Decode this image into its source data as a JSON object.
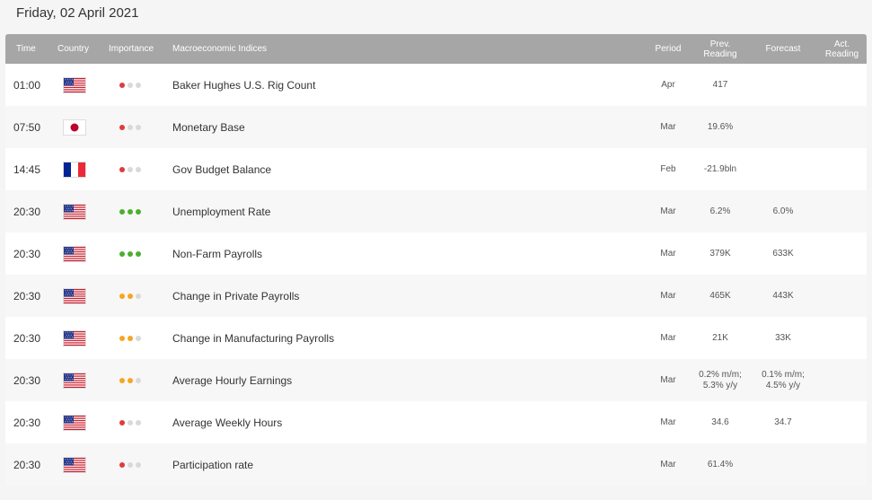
{
  "date_title": "Friday, 02 April 2021",
  "header": {
    "time": "Time",
    "country": "Country",
    "importance": "Importance",
    "indices": "Macroeconomic Indices",
    "period": "Period",
    "prev": "Prev.\nReading",
    "forecast": "Forecast",
    "actual": "Act.\nReading"
  },
  "colors": {
    "header_bg": "#a6a6a6",
    "importance_high": "#4caf2f",
    "importance_medium": "#f5a623",
    "importance_low": "#e03b3b",
    "importance_off": "#d9d9d9"
  },
  "rows": [
    {
      "time": "01:00",
      "country": "us",
      "importance": "low",
      "name": "Baker Hughes U.S. Rig Count",
      "period": "Apr",
      "prev": "417",
      "forecast": "",
      "actual": ""
    },
    {
      "time": "07:50",
      "country": "jp",
      "importance": "low",
      "name": "Monetary Base",
      "period": "Mar",
      "prev": "19.6%",
      "forecast": "",
      "actual": ""
    },
    {
      "time": "14:45",
      "country": "fr",
      "importance": "low",
      "name": "Gov Budget Balance",
      "period": "Feb",
      "prev": "-21.9bln",
      "forecast": "",
      "actual": ""
    },
    {
      "time": "20:30",
      "country": "us",
      "importance": "high",
      "name": "Unemployment Rate",
      "period": "Mar",
      "prev": "6.2%",
      "forecast": "6.0%",
      "actual": ""
    },
    {
      "time": "20:30",
      "country": "us",
      "importance": "high",
      "name": "Non-Farm Payrolls",
      "period": "Mar",
      "prev": "379K",
      "forecast": "633K",
      "actual": ""
    },
    {
      "time": "20:30",
      "country": "us",
      "importance": "medium",
      "name": "Change in Private Payrolls",
      "period": "Mar",
      "prev": "465K",
      "forecast": "443K",
      "actual": ""
    },
    {
      "time": "20:30",
      "country": "us",
      "importance": "medium",
      "name": "Change in Manufacturing Payrolls",
      "period": "Mar",
      "prev": "21K",
      "forecast": "33K",
      "actual": ""
    },
    {
      "time": "20:30",
      "country": "us",
      "importance": "medium",
      "name": "Average Hourly Earnings",
      "period": "Mar",
      "prev": "0.2% m/m;\n5.3% y/y",
      "forecast": "0.1% m/m;\n4.5% y/y",
      "actual": ""
    },
    {
      "time": "20:30",
      "country": "us",
      "importance": "low",
      "name": "Average Weekly Hours",
      "period": "Mar",
      "prev": "34.6",
      "forecast": "34.7",
      "actual": ""
    },
    {
      "time": "20:30",
      "country": "us",
      "importance": "low",
      "name": "Participation rate",
      "period": "Mar",
      "prev": "61.4%",
      "forecast": "",
      "actual": ""
    }
  ]
}
